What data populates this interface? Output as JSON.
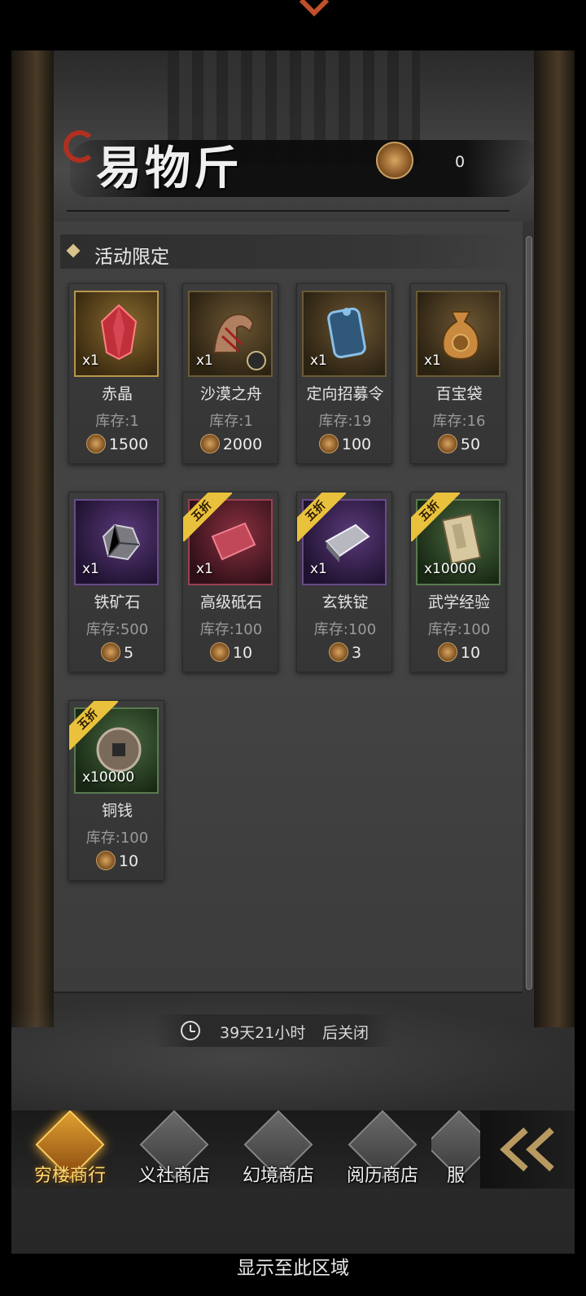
{
  "shop": {
    "title": "易物斤",
    "currency_balance": "0",
    "section_title": "活动限定"
  },
  "labels": {
    "stock_prefix": "库存:",
    "discount_badge": "五折"
  },
  "items": [
    {
      "name": "赤晶",
      "qty": "x1",
      "stock": "1",
      "price": "1500",
      "discount": false
    },
    {
      "name": "沙漠之舟",
      "qty": "x1",
      "stock": "1",
      "price": "2000",
      "discount": false
    },
    {
      "name": "定向招募令",
      "qty": "x1",
      "stock": "19",
      "price": "100",
      "discount": false
    },
    {
      "name": "百宝袋",
      "qty": "x1",
      "stock": "16",
      "price": "50",
      "discount": false
    },
    {
      "name": "铁矿石",
      "qty": "x1",
      "stock": "500",
      "price": "5",
      "discount": false
    },
    {
      "name": "高级砥石",
      "qty": "x1",
      "stock": "100",
      "price": "10",
      "discount": true
    },
    {
      "name": "玄铁锭",
      "qty": "x1",
      "stock": "100",
      "price": "3",
      "discount": true
    },
    {
      "name": "武学经验",
      "qty": "x10000",
      "stock": "100",
      "price": "10",
      "discount": true
    },
    {
      "name": "铜钱",
      "qty": "x10000",
      "stock": "100",
      "price": "10",
      "discount": true
    }
  ],
  "timer": {
    "remaining": "39天21小时",
    "suffix": "后关闭"
  },
  "nav": {
    "items": [
      {
        "label": "穷楼商行",
        "active": true
      },
      {
        "label": "义社商店",
        "active": false
      },
      {
        "label": "幻境商店",
        "active": false
      },
      {
        "label": "阅历商店",
        "active": false
      },
      {
        "label": "服",
        "active": false
      }
    ]
  },
  "footer": {
    "text": "显示至此区域"
  },
  "colors": {
    "gold_accent": "#e9c13c",
    "nav_active": "#ffd870",
    "title_seal": "#b03020"
  }
}
